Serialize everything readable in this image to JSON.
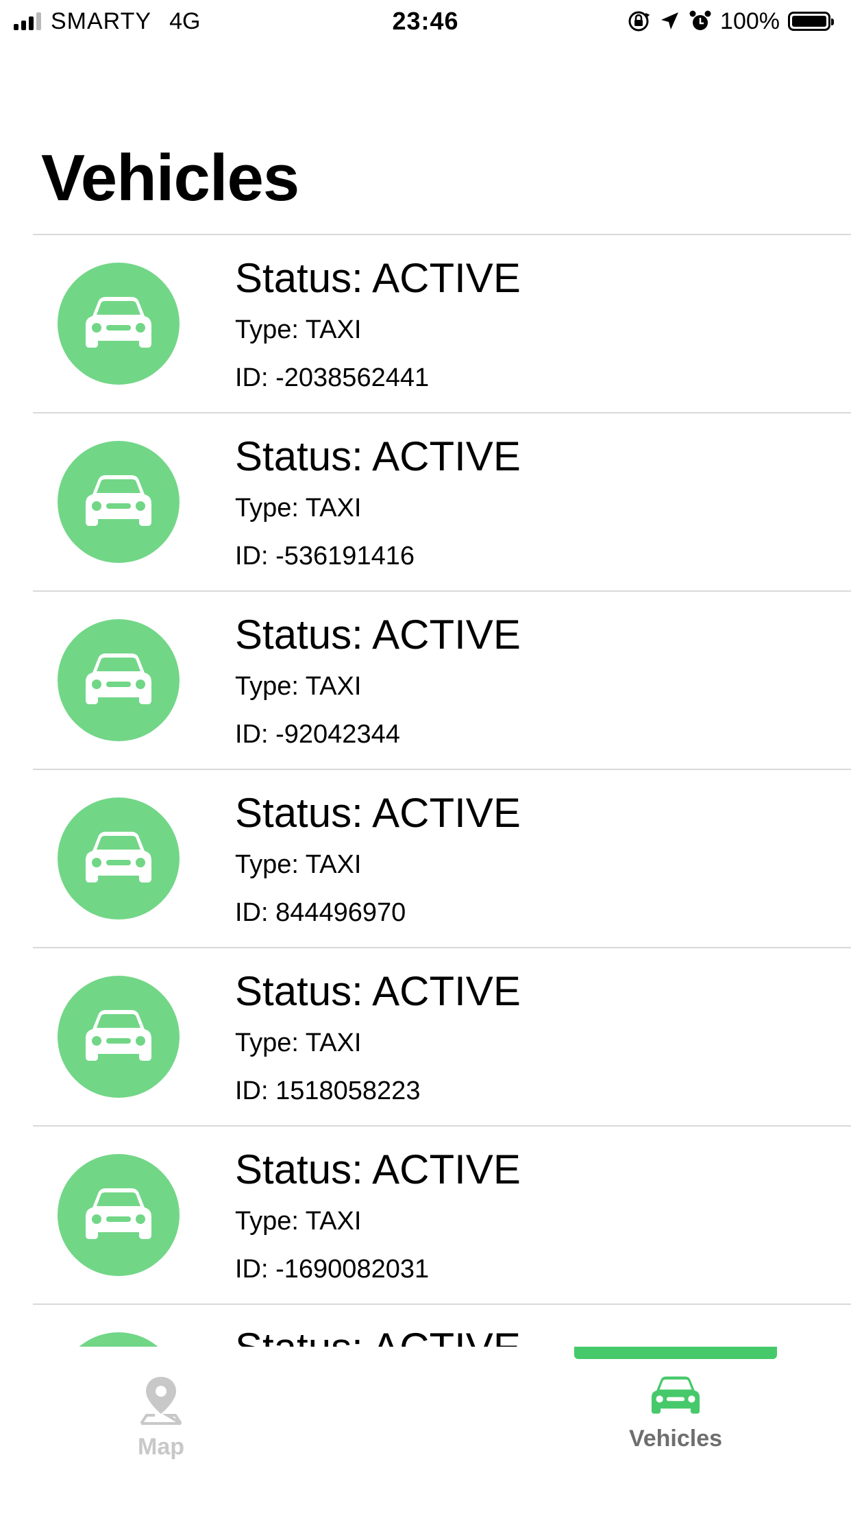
{
  "status_bar": {
    "carrier": "SMARTY",
    "network": "4G",
    "time": "23:46",
    "battery": "100%"
  },
  "page": {
    "title": "Vehicles"
  },
  "colors": {
    "accent": "#46c96a",
    "avatar_bg": "#72d687",
    "inactive_tab": "#c8c8c8",
    "active_tab_label": "#6e6e6e"
  },
  "vehicles": [
    {
      "status": "Status: ACTIVE",
      "type": "Type: TAXI",
      "id": "ID: -2038562441",
      "icon": "car-icon"
    },
    {
      "status": "Status: ACTIVE",
      "type": "Type: TAXI",
      "id": "ID: -536191416",
      "icon": "car-icon"
    },
    {
      "status": "Status: ACTIVE",
      "type": "Type: TAXI",
      "id": "ID: -92042344",
      "icon": "car-icon"
    },
    {
      "status": "Status: ACTIVE",
      "type": "Type: TAXI",
      "id": "ID: 844496970",
      "icon": "car-icon"
    },
    {
      "status": "Status: ACTIVE",
      "type": "Type: TAXI",
      "id": "ID: 1518058223",
      "icon": "car-icon"
    },
    {
      "status": "Status: ACTIVE",
      "type": "Type: TAXI",
      "id": "ID: -1690082031",
      "icon": "car-icon"
    },
    {
      "status": "Status: ACTIVE",
      "type": "",
      "id": "",
      "icon": "car-icon"
    }
  ],
  "tabbar": {
    "map_label": "Map",
    "map_icon": "map-pin-icon",
    "vehicles_label": "Vehicles",
    "vehicles_icon": "car-icon",
    "selected": "Vehicles"
  }
}
